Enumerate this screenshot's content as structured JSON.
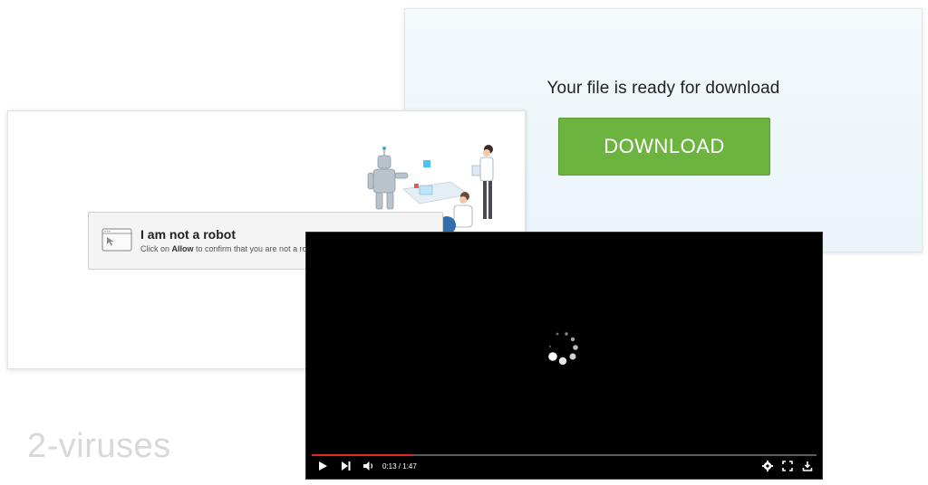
{
  "download": {
    "title": "Your file is ready for download",
    "button_label": "DOWNLOAD"
  },
  "captcha": {
    "title": "I am not a robot",
    "text_prefix": "Click on ",
    "text_bold": "Allow",
    "text_suffix": " to confirm that you are not a ro"
  },
  "video": {
    "time": "0:13 / 1:47",
    "progress": 0.199,
    "icons": [
      "play-icon",
      "skip-next-icon",
      "volume-icon",
      "settings-icon",
      "fullscreen-icon",
      "download-icon"
    ]
  },
  "watermark": "2-viruses",
  "colors": {
    "download_green": "#6db33f",
    "progress_red": "#e12a26",
    "player_bg": "#000000"
  }
}
